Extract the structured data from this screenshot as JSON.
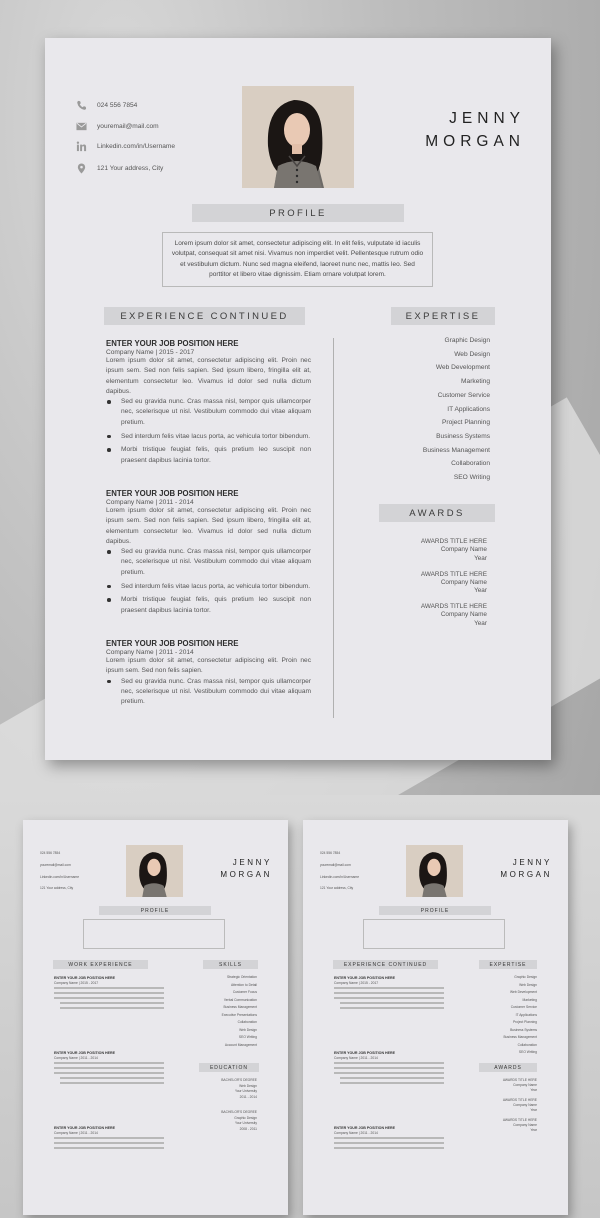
{
  "contact": {
    "phone": "024 556 7854",
    "email": "youremail@mail.com",
    "linkedin": "Linkedin.com/in/Username",
    "address": "121 Your address, City"
  },
  "name": {
    "first": "JENNY",
    "last": "MORGAN"
  },
  "profile": {
    "heading": "PROFILE",
    "text": "Lorem ipsum dolor sit amet, consectetur adipiscing elit. In elit felis, vulputate id iaculis volutpat, consequat sit amet nisi. Vivamus non imperdiet velit. Pellentesque rutrum odio et vestibulum dictum. Nunc sed magna eleifend, laoreet nunc nec, mattis leo. Sed porttitor et libero vitae dignissim. Etiam ornare volutpat lorem."
  },
  "experience": {
    "heading": "EXPERIENCE CONTINUED",
    "jobs": [
      {
        "title": "ENTER YOUR JOB POSITION HERE",
        "meta": "Company Name | 2015 - 2017",
        "desc": "Lorem ipsum dolor sit amet, consectetur adipiscing elit. Proin nec ipsum sem. Sed non felis sapien. Sed ipsum libero, fringilla elit at, elementum consectetur leo. Vivamus id dolor sed nulla dictum dapibus.",
        "bullets": [
          "Sed eu gravida nunc. Cras massa nisl, tempor quis ullamcorper nec, scelerisque ut nisl. Vestibulum commodo dui vitae aliquam pretium.",
          "Sed interdum felis vitae lacus porta, ac vehicula tortor bibendum.",
          "Morbi tristique feugiat felis, quis pretium leo suscipit non praesent dapibus lacinia tortor."
        ]
      },
      {
        "title": "ENTER YOUR JOB POSITION HERE",
        "meta": "Company Name | 2011 - 2014",
        "desc": "Lorem ipsum dolor sit amet, consectetur adipiscing elit. Proin nec ipsum sem. Sed non felis sapien. Sed ipsum libero, fringilla elit at, elementum consectetur leo. Vivamus id dolor sed nulla dictum dapibus.",
        "bullets": [
          "Sed eu gravida nunc. Cras massa nisl, tempor quis ullamcorper nec, scelerisque ut nisl. Vestibulum commodo dui vitae aliquam pretium.",
          "Sed interdum felis vitae lacus porta, ac vehicula tortor bibendum.",
          "Morbi tristique feugiat felis, quis pretium leo suscipit non praesent dapibus lacinia tortor."
        ]
      },
      {
        "title": "ENTER YOUR JOB POSITION HERE",
        "meta": "Company Name | 2011 - 2014",
        "desc": "Lorem ipsum dolor sit amet, consectetur adipiscing elit. Proin nec ipsum sem. Sed non felis sapien.",
        "bullets": [
          "Sed eu gravida nunc. Cras massa nisl, tempor quis ullamcorper nec, scelerisque ut nisl. Vestibulum commodo dui vitae aliquam pretium."
        ]
      }
    ]
  },
  "expertise": {
    "heading": "EXPERTISE",
    "items": [
      "Graphic Design",
      "Web Design",
      "Web Development",
      "Marketing",
      "Customer Service",
      "IT Applications",
      "Project Planning",
      "Business Systems",
      "Business Management",
      "Collaboration",
      "SEO Writing"
    ]
  },
  "awards": {
    "heading": "AWARDS",
    "items": [
      {
        "title": "AWARDS TITLE HERE",
        "company": "Company Name",
        "year": "Year"
      },
      {
        "title": "AWARDS TITLE HERE",
        "company": "Company Name",
        "year": "Year"
      },
      {
        "title": "AWARDS TITLE HERE",
        "company": "Company Name",
        "year": "Year"
      }
    ]
  },
  "thumb_left": {
    "experience_heading": "WORK EXPERIENCE",
    "skills_heading": "SKILLS",
    "skills": [
      "Strategic Orientation",
      "Attention to Detail",
      "Customer Focus",
      "Verbal Communication",
      "Business Management",
      "Executive Presentations",
      "Collaboration",
      "Web Design",
      "SEO Writing",
      "Account Management"
    ],
    "education_heading": "EDUCATION",
    "education": [
      {
        "degree": "BACHELOR'S DEGREE",
        "field": "Web Design",
        "school": "Your University",
        "years": "2011 - 2014"
      },
      {
        "degree": "BACHELOR'S DEGREE",
        "field": "Graphic Design",
        "school": "Your University",
        "years": "2008 - 2011"
      }
    ]
  }
}
